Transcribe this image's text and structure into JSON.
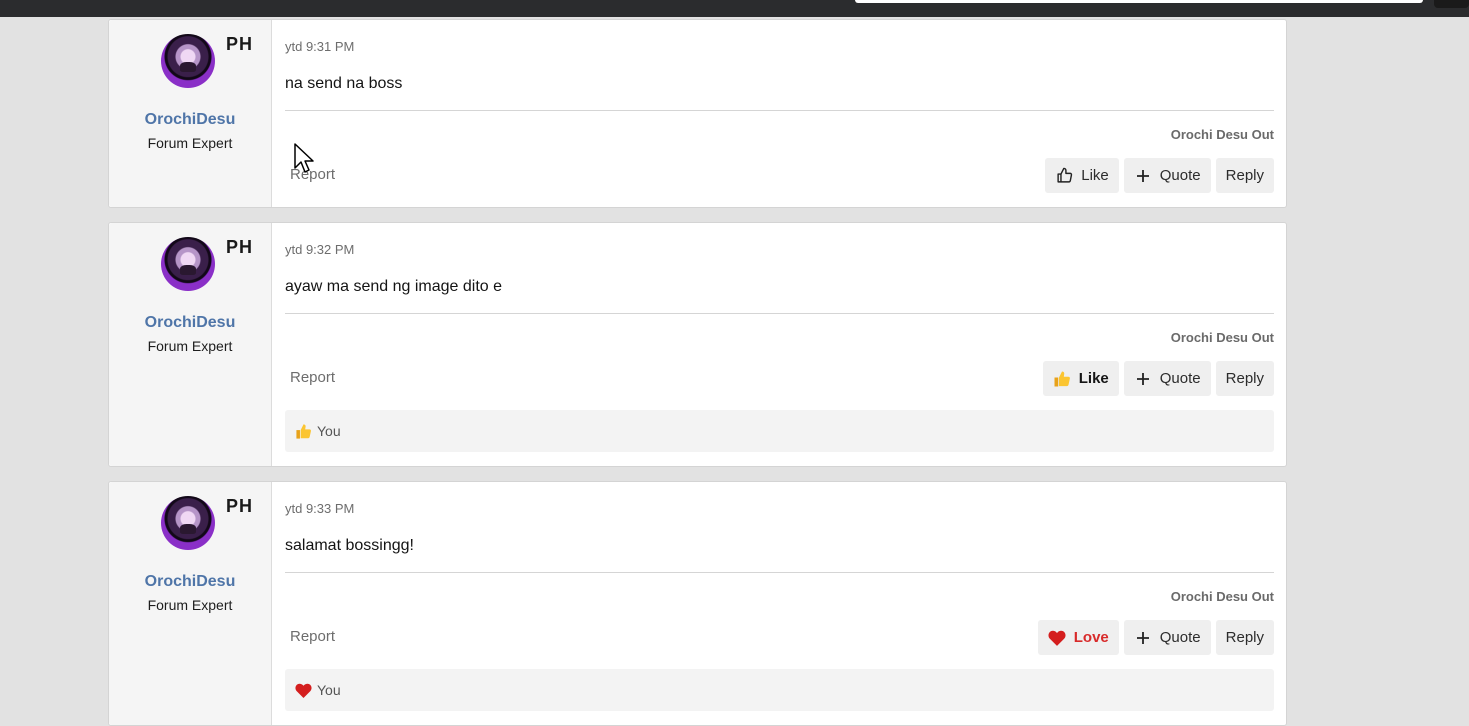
{
  "posts": [
    {
      "user": {
        "name": "OrochiDesu",
        "title": "Forum Expert",
        "flag": "PH"
      },
      "time": "ytd 9:31 PM",
      "message": "na send na boss",
      "signature": "Orochi Desu Out",
      "report_label": "Report",
      "reaction_button": {
        "label": "Like",
        "state": "none",
        "icon": "thumbs-up-outline-icon"
      },
      "quote_label": "Quote",
      "reply_label": "Reply",
      "reactions": null
    },
    {
      "user": {
        "name": "OrochiDesu",
        "title": "Forum Expert",
        "flag": "PH"
      },
      "time": "ytd 9:32 PM",
      "message": "ayaw ma send ng image dito e",
      "signature": "Orochi Desu Out",
      "report_label": "Report",
      "reaction_button": {
        "label": "Like",
        "state": "liked",
        "icon": "thumbs-up-emoji-icon"
      },
      "quote_label": "Quote",
      "reply_label": "Reply",
      "reactions": {
        "icon": "thumbs-up-emoji-icon",
        "text": "You"
      }
    },
    {
      "user": {
        "name": "OrochiDesu",
        "title": "Forum Expert",
        "flag": "PH"
      },
      "time": "ytd 9:33 PM",
      "message": "salamat bossingg!",
      "signature": "Orochi Desu Out",
      "report_label": "Report",
      "reaction_button": {
        "label": "Love",
        "state": "loved",
        "icon": "heart-icon"
      },
      "quote_label": "Quote",
      "reply_label": "Reply",
      "reactions": {
        "icon": "heart-icon",
        "text": "You"
      }
    }
  ],
  "colors": {
    "username": "#4f75a8",
    "love": "#d82a2a",
    "page_bg": "#e2e2e2",
    "topbar": "#2b2c2e"
  }
}
